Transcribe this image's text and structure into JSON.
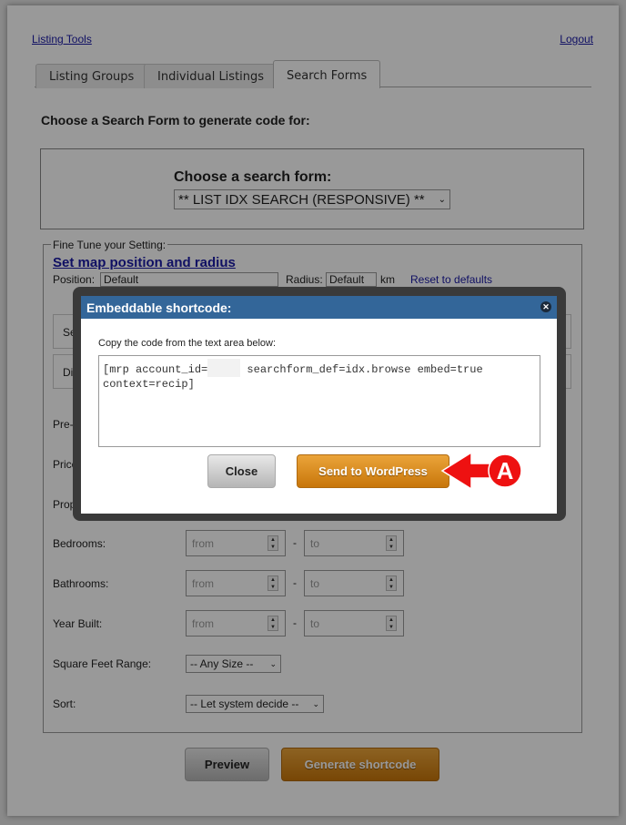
{
  "header": {
    "left_link": "Listing Tools",
    "right_link": "Logout"
  },
  "tabs": [
    {
      "label": "Listing Groups"
    },
    {
      "label": "Individual Listings"
    },
    {
      "label": "Search Forms",
      "active": true
    }
  ],
  "main": {
    "heading": "Choose a Search Form to generate code for:",
    "choose_label": "Choose a search form:",
    "choose_value": "** LIST IDX SEARCH (RESPONSIVE) **"
  },
  "fine_tune": {
    "legend": "Fine Tune your Setting:",
    "map_link": "Set map position and radius",
    "position_label": "Position:",
    "position_value": "Default",
    "radius_label": "Radius:",
    "radius_value": "Default",
    "km": "km",
    "reset": "Reset to defaults",
    "partial_labels": [
      "Sea",
      "Disa",
      "Pre-s",
      "Price:",
      "Prope"
    ],
    "ranges": [
      {
        "label": "Bedrooms:",
        "from": "from",
        "to": "to"
      },
      {
        "label": "Bathrooms:",
        "from": "from",
        "to": "to"
      },
      {
        "label": "Year Built:",
        "from": "from",
        "to": "to"
      }
    ],
    "range_sep": "-",
    "sqft_label": "Square Feet Range:",
    "sqft_value": "-- Any Size --",
    "sort_label": "Sort:",
    "sort_value": "-- Let system decide --"
  },
  "actions": {
    "preview": "Preview",
    "generate": "Generate shortcode"
  },
  "modal": {
    "title": "Embeddable shortcode:",
    "instruction": "Copy the code from the text area below:",
    "code_part1": "[mrp account_id=",
    "code_part2": " searchform_def=idx.browse embed=true\ncontext=recip]",
    "close": "Close",
    "send": "Send to WordPress"
  },
  "annotation": {
    "letter": "A",
    "color": "#ee1111"
  },
  "colors": {
    "modal_header": "#336699",
    "orange_button": "#d9891f"
  }
}
